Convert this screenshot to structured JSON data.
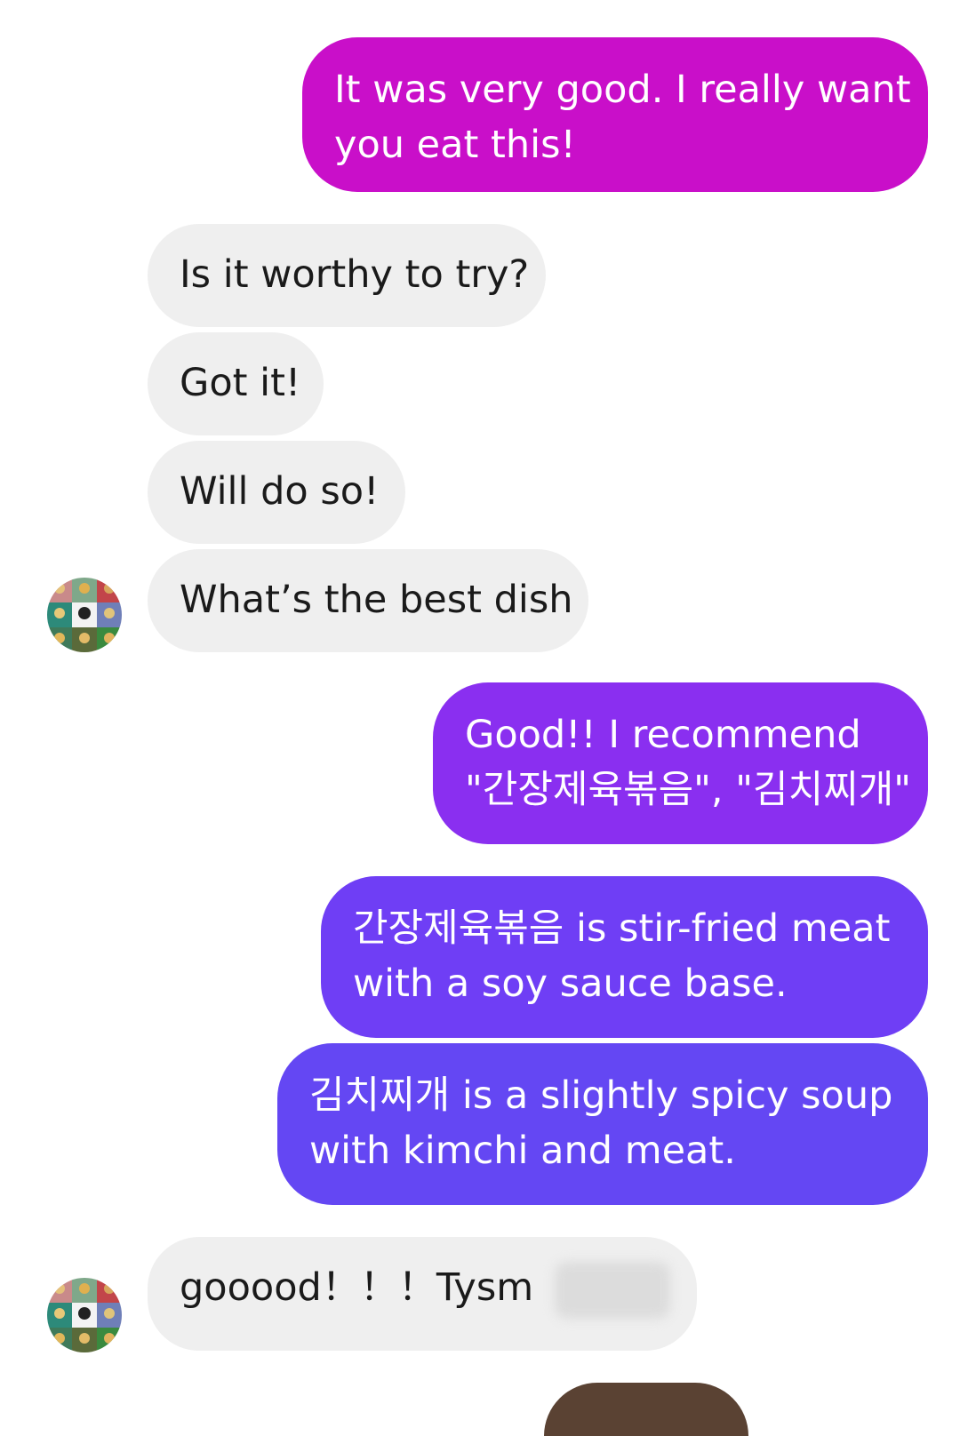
{
  "messages": [
    {
      "id": "m1",
      "side": "out",
      "lines": [
        "It was very good. I really want",
        "you eat this!"
      ],
      "color": "#c90fc9"
    },
    {
      "id": "m2",
      "side": "in",
      "lines": [
        "Is it worthy to try?"
      ]
    },
    {
      "id": "m3",
      "side": "in",
      "lines": [
        "Got it!"
      ]
    },
    {
      "id": "m4",
      "side": "in",
      "lines": [
        "Will do so!"
      ]
    },
    {
      "id": "m5",
      "side": "in",
      "lines": [
        "What’s the best dish"
      ]
    },
    {
      "id": "m6",
      "side": "out",
      "lines": [
        "Good!! I recommend",
        "\"간장제육볶음\", \"김치찌개\""
      ],
      "color": "#8a2ff0"
    },
    {
      "id": "m7",
      "side": "out",
      "lines": [
        "간장제육볶음 is stir-fried meat",
        "with a soy sauce base."
      ],
      "color": "#6f3ef5"
    },
    {
      "id": "m8",
      "side": "out",
      "lines": [
        "김치찌개 is a slightly spicy soup",
        "with kimchi and meat."
      ],
      "color": "#6447f3"
    },
    {
      "id": "m9",
      "side": "in",
      "lines": [
        "gooood！！！Tysm"
      ]
    }
  ],
  "avatar": {
    "icon": "contact-avatar-icon"
  }
}
